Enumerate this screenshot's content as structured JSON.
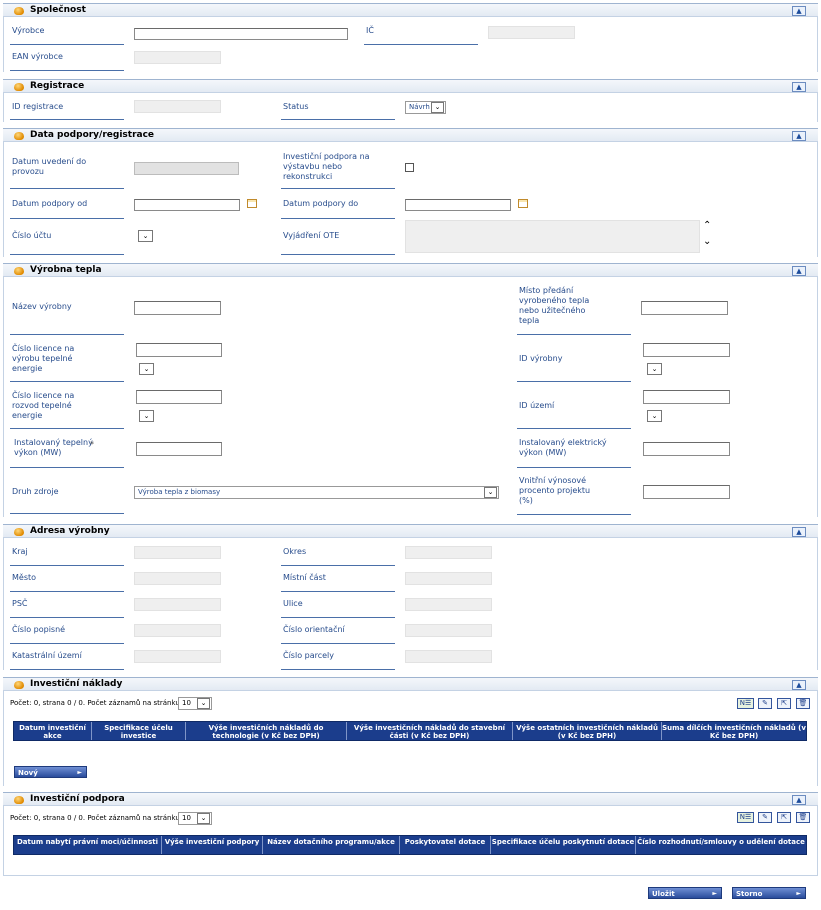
{
  "sections": {
    "spolecnost": "Společnost",
    "registrace": "Registrace",
    "data_podpory": "Data podpory/registrace",
    "vyrobna_tepla": "Výrobna tepla",
    "adresa": "Adresa výrobny",
    "investicni_naklady": "Investiční náklady",
    "investicni_podpora": "Investiční podpora"
  },
  "collapse_glyph": "▲",
  "spolecnost": {
    "vyrobce": "Výrobce",
    "ic": "IČ",
    "ean": "EAN výrobce"
  },
  "registrace": {
    "id": "ID registrace",
    "status": "Status",
    "status_value": "Návrh"
  },
  "data_podpory": {
    "datum_uvedeni": "Datum uvedení do provozu",
    "investicni_podpora": "Investiční podpora na výstavbu nebo rekonstrukci",
    "datum_od": "Datum podpory od",
    "datum_do": "Datum podpory do",
    "cislo_uctu": "Číslo účtu",
    "vyjadreni_ote": "Vyjádření OTE"
  },
  "vyrobna": {
    "nazev": "Název výrobny",
    "misto_predani": "Místo předání vyrobeného tepla nebo užitečného tepla",
    "licence_vyroba": "Číslo licence na výrobu tepelné energie",
    "id_vyrobny": "ID výrobny",
    "licence_rozvod": "Číslo licence na rozvod tepelné energie",
    "id_uzemi": "ID území",
    "tepelny_vykon": "Instalovaný tepelný výkon (MW)",
    "required_mark": "*",
    "elektricky_vykon": "Instalovaný elektrický výkon (MW)",
    "druh_zdroje": "Druh zdroje",
    "druh_zdroje_value": "Výroba tepla z biomasy",
    "vnitrni_vynosove": "Vnitřní výnosové procento projektu (%)"
  },
  "adresa": {
    "kraj": "Kraj",
    "okres": "Okres",
    "mesto": "Město",
    "mistni_cast": "Místní část",
    "psc": "PSČ",
    "ulice": "Ulice",
    "cislo_popisne": "Číslo popisné",
    "cislo_orientacni": "Číslo orientační",
    "katastralni_uzemi": "Katastrální území",
    "cislo_parcely": "Číslo parcely"
  },
  "pager": {
    "text": "Počet: 0, strana 0 / 0. Počet záznamů na stránku",
    "page_size": "10"
  },
  "naklady_table": {
    "columns": [
      "Datum investiční akce",
      "Specifikace účelu investice",
      "Výše investičních nákladů do technologie (v Kč bez DPH)",
      "Výše investičních nákladů do stavební části (v Kč bez DPH)",
      "Výše ostatních investičních nákladů (v Kč bez DPH)",
      "Suma dílčích investičních nákladů (v Kč bez DPH)"
    ],
    "new_button": "Nový"
  },
  "podpora_table": {
    "columns": [
      "Datum nabytí právní moci/účinnosti",
      "Výše investiční podpory",
      "Název dotačního programu/akce",
      "Poskytovatel dotace",
      "Specifikace účelu poskytnutí dotace",
      "Číslo rozhodnutí/smlouvy o udělení dotace"
    ]
  },
  "footer": {
    "save": "Uložit",
    "cancel": "Storno"
  },
  "icons": {
    "dropdown": "⌄",
    "arrow_right": "►",
    "scroll_up": "⌃",
    "scroll_down": "⌄",
    "tool_new": "N☰",
    "tool_edit": "✎",
    "tool_export": "⇱",
    "tool_delete": "🗑"
  }
}
